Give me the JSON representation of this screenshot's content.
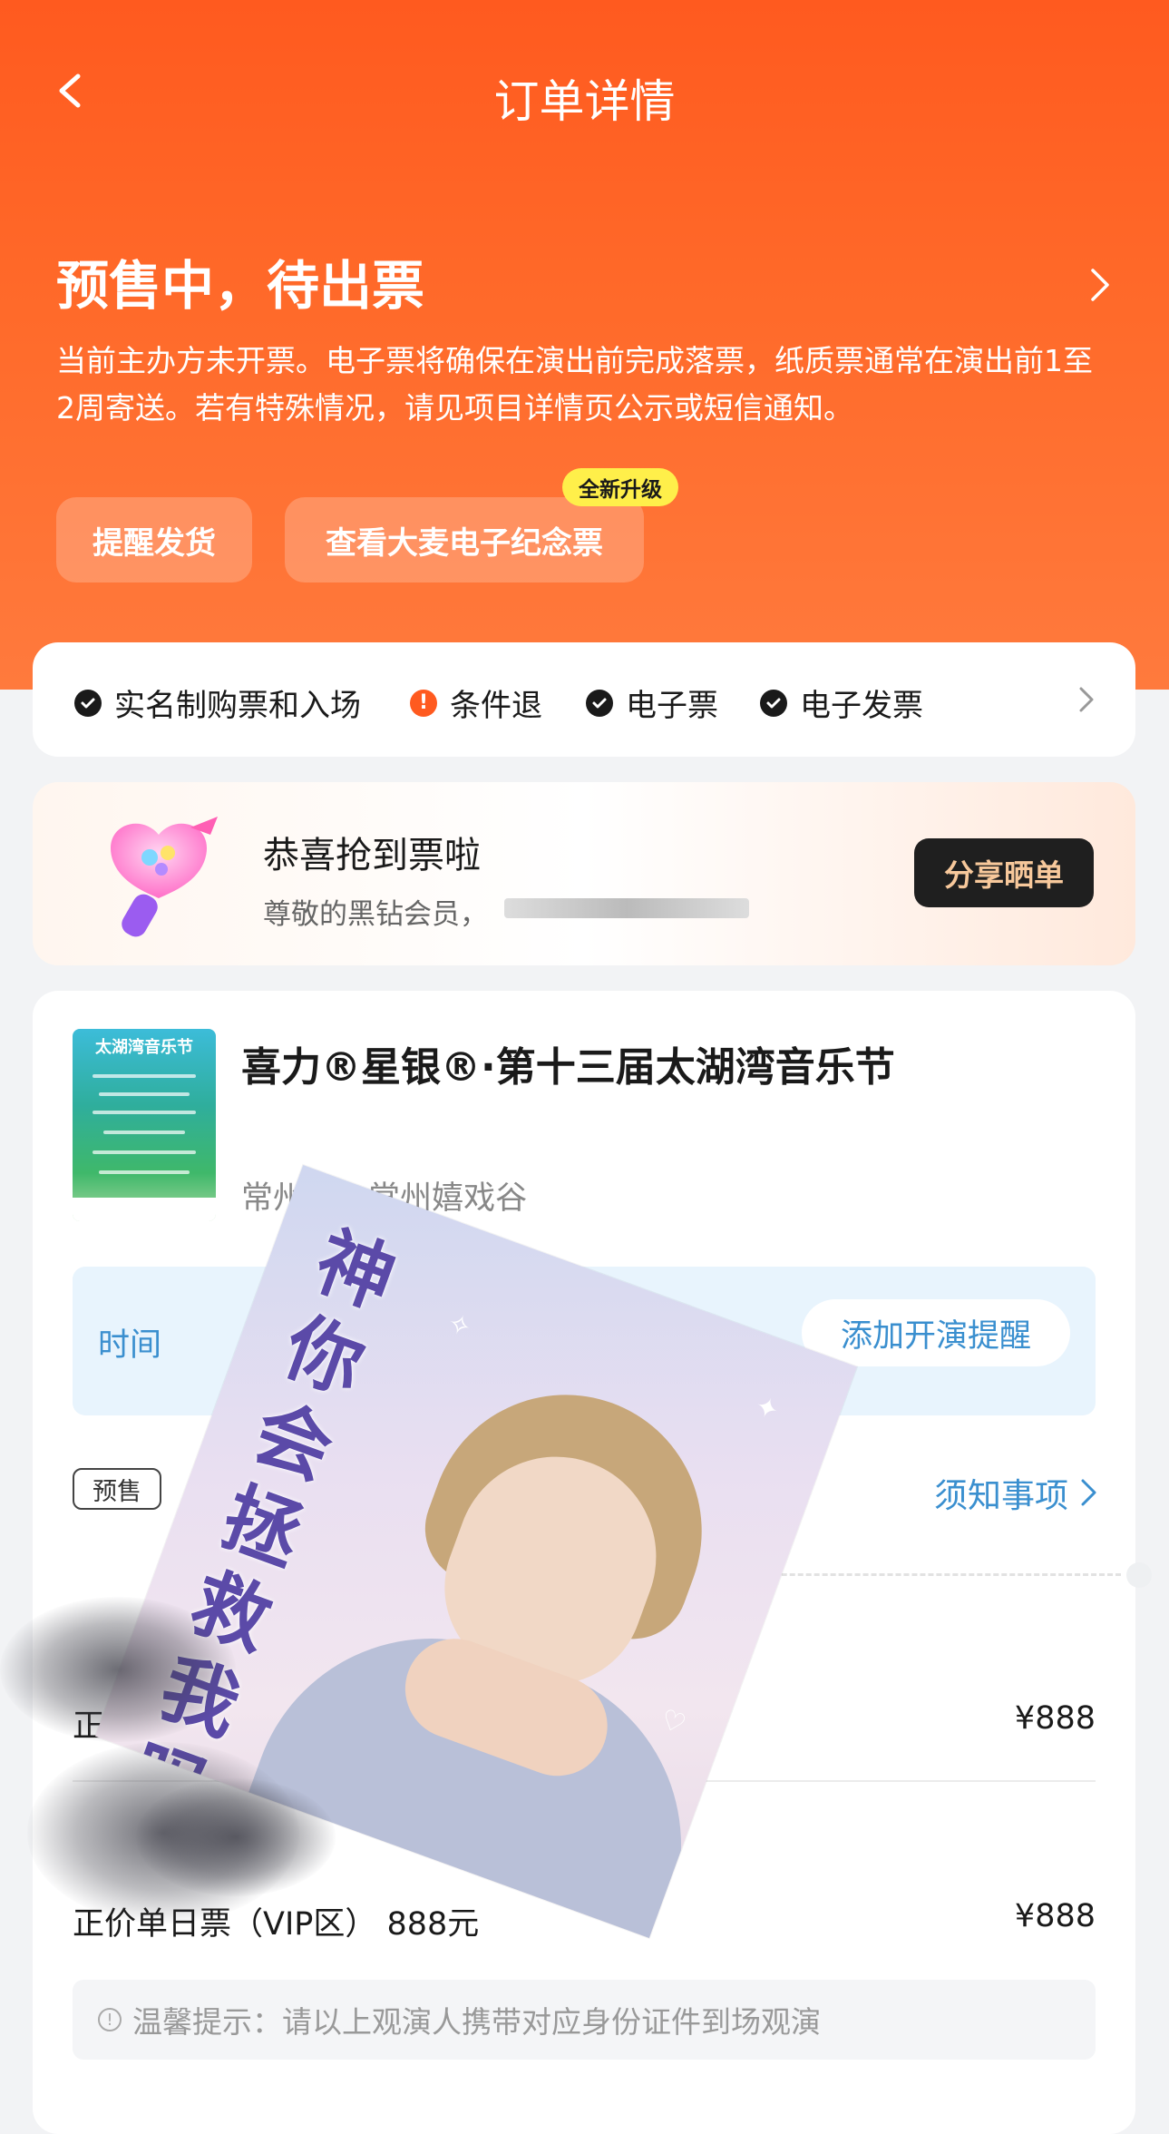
{
  "header": {
    "title": "订单详情",
    "back_icon": "chevron-left-icon"
  },
  "status": {
    "title": "预售中，待出票",
    "description": "当前主办方未开票。电子票将确保在演出前完成落票，纸质票通常在演出前1至2周寄送。若有特殊情况，请见项目详情页公示或短信通知。",
    "buttons": {
      "remind": "提醒发货",
      "ticket": "查看大麦电子纪念票"
    },
    "new_badge": "全新升级"
  },
  "features": [
    {
      "label": "实名制购票和入场",
      "icon": "check-circle-icon"
    },
    {
      "label": "条件退",
      "icon": "warning-circle-icon"
    },
    {
      "label": "电子票",
      "icon": "check-circle-icon"
    },
    {
      "label": "电子发票",
      "icon": "check-circle-icon"
    }
  ],
  "congrats": {
    "title": "恭喜抢到票啦",
    "subtitle": "尊敬的黑钻会员，",
    "share_label": "分享晒单"
  },
  "event": {
    "poster_title": "太湖湾音乐节",
    "name": "喜力®星银®·第十三届太湖湾音乐节",
    "city": "常州",
    "separator": "|",
    "venue": "常州嬉戏谷"
  },
  "time_box": {
    "label": "时间",
    "add_reminder": "添加开演提醒"
  },
  "presale_tag": "预售",
  "notice_link": "须知事项",
  "tickets": [
    {
      "name": "正价",
      "price": "¥888"
    },
    {
      "name": "正价单日票（VIP区） 888元",
      "price": "¥888"
    }
  ],
  "tip": "温馨提示：请以上观演人携带对应身份证件到场观演",
  "sticker_text": "神你会拯救我吗",
  "colors": {
    "primary": "#ff5a1f",
    "link": "#3a8fcf",
    "badge": "#ffef4a",
    "share_text": "#f7c89b"
  }
}
